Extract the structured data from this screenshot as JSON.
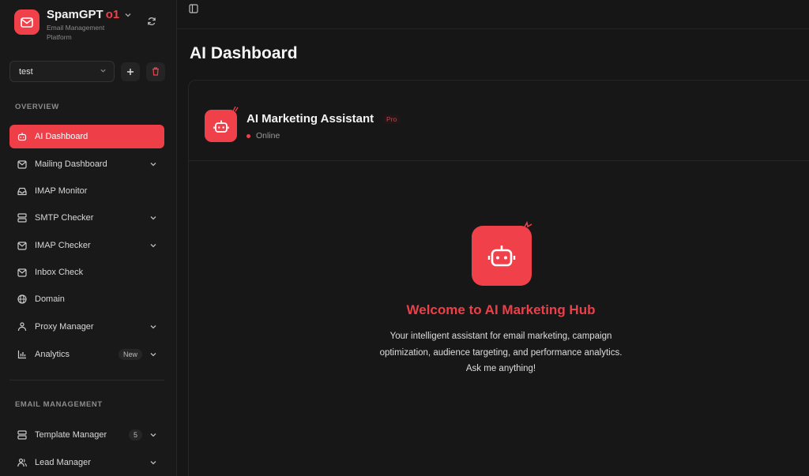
{
  "brand": {
    "title": "SpamGPT",
    "version": "o1",
    "subtitle": "Email Management Platform",
    "accent": "#f0414a"
  },
  "workspace": {
    "selected": "test"
  },
  "sidebar": {
    "overview_label": "OVERVIEW",
    "email_management_label": "EMAIL MANAGEMENT",
    "items": [
      {
        "label": "AI Dashboard",
        "icon": "bot-icon",
        "active": true
      },
      {
        "label": "Mailing Dashboard",
        "icon": "mail-icon",
        "chevron": true
      },
      {
        "label": "IMAP Monitor",
        "icon": "inbox-icon"
      },
      {
        "label": "SMTP Checker",
        "icon": "server-icon",
        "chevron": true
      },
      {
        "label": "IMAP Checker",
        "icon": "mail-icon",
        "chevron": true
      },
      {
        "label": "Inbox Check",
        "icon": "mail-icon"
      },
      {
        "label": "Domain",
        "icon": "globe-icon"
      },
      {
        "label": "Proxy Manager",
        "icon": "network-icon",
        "chevron": true
      },
      {
        "label": "Analytics",
        "icon": "bar-chart-icon",
        "badge": "New",
        "chevron": true
      }
    ],
    "email_items": [
      {
        "label": "Template Manager",
        "icon": "layers-icon",
        "badge": "5",
        "chevron": true
      },
      {
        "label": "Lead Manager",
        "icon": "users-icon",
        "chevron": true
      }
    ]
  },
  "main": {
    "page_title": "AI Dashboard",
    "assistant": {
      "name": "AI Marketing Assistant",
      "badge": "Pro",
      "status": "Online"
    },
    "hero": {
      "title": "Welcome to AI Marketing Hub",
      "lines": [
        "Your intelligent assistant for email marketing, campaign",
        "optimization, audience targeting, and performance analytics.",
        "Ask me anything!"
      ]
    }
  }
}
